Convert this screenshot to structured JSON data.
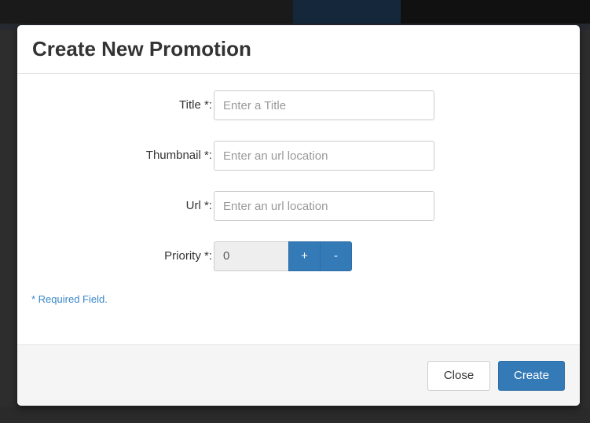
{
  "modal": {
    "title": "Create New Promotion",
    "fields": [
      {
        "label": "Title *:",
        "placeholder": "Enter a Title"
      },
      {
        "label": "Thumbnail *:",
        "placeholder": "Enter an url location"
      },
      {
        "label": "Url *:",
        "placeholder": "Enter an url location"
      }
    ],
    "priority": {
      "label": "Priority *:",
      "value": "0",
      "plus_label": "+",
      "minus_label": "-"
    },
    "required_note": "* Required Field.",
    "footer": {
      "close_label": "Close",
      "create_label": "Create"
    }
  },
  "colors": {
    "primary": "#337ab7",
    "note": "#3a87c8"
  }
}
